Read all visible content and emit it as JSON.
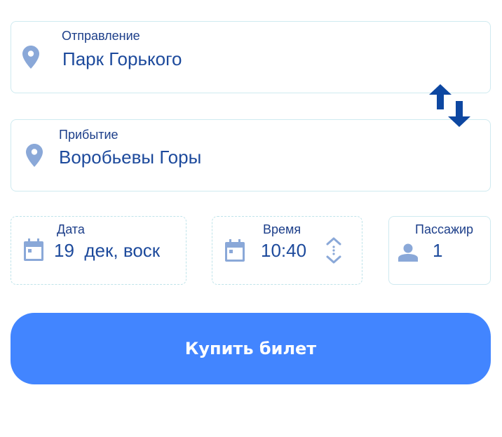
{
  "departure": {
    "label": "Отправление",
    "value": "Парк Горького",
    "icon": "map-pin-icon"
  },
  "arrival": {
    "label": "Прибытие",
    "value": "Воробьевы Горы",
    "icon": "map-pin-icon"
  },
  "swap": {
    "icon": "swap-arrows-icon"
  },
  "date": {
    "label": "Дата",
    "value": "19  дек, воск",
    "icon": "calendar-icon"
  },
  "time": {
    "label": "Время",
    "value": "10:40",
    "icon": "calendar-icon",
    "stepper_icon": "up-down-chevrons-icon"
  },
  "passengers": {
    "label": "Пассажир",
    "value": "1",
    "icon": "person-icon"
  },
  "buy_button": {
    "label": "Купить билет"
  },
  "colors": {
    "accent": "#4285ff",
    "text": "#1d4a9c",
    "icon": "#8aa8d8",
    "arrow": "#0d47a1"
  }
}
